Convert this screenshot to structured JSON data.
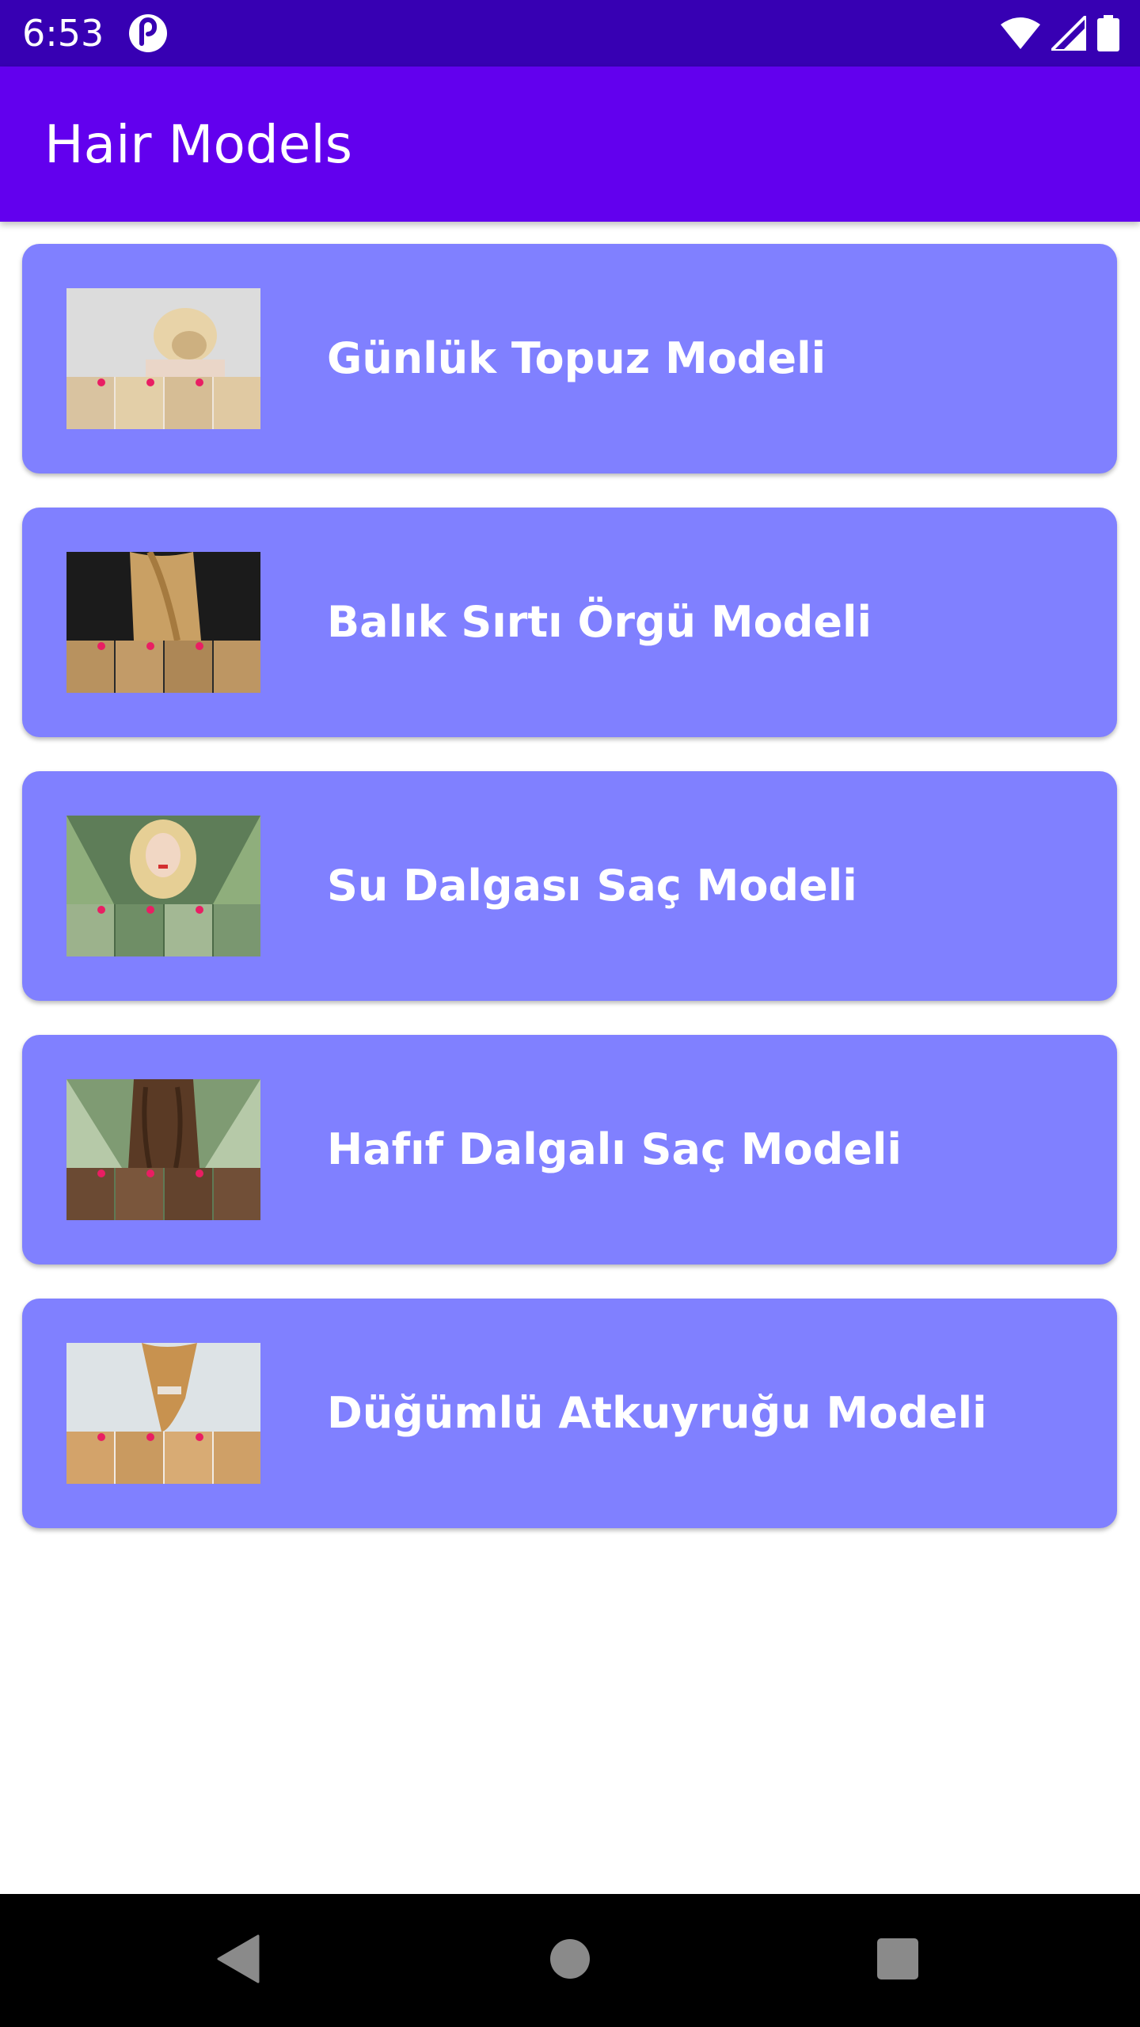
{
  "status_bar": {
    "time": "6:53",
    "icons": [
      "app-notification-icon",
      "wifi-icon",
      "signal-icon",
      "battery-icon"
    ]
  },
  "app_bar": {
    "title": "Hair Models",
    "color": "#6200ee"
  },
  "colors": {
    "status_bar": "#3700b3",
    "card_background": "#8080ff",
    "card_text": "#ffffff"
  },
  "models": [
    {
      "label": "Günlük Topuz Modeli",
      "thumbnail": "bun-hairstyle-tutorial-image"
    },
    {
      "label": "Balık Sırtı Örgü Modeli",
      "thumbnail": "fishtail-braid-tutorial-image"
    },
    {
      "label": "Su Dalgası Saç Modeli",
      "thumbnail": "water-wave-hair-tutorial-image"
    },
    {
      "label": "Hafıf Dalgalı Saç Modeli",
      "thumbnail": "light-wavy-hair-tutorial-image"
    },
    {
      "label": "Düğümlü Atkuyruğu Modeli",
      "thumbnail": "knotted-ponytail-tutorial-image"
    }
  ],
  "nav_bar": {
    "buttons": [
      "back-icon",
      "home-icon",
      "recents-icon"
    ]
  }
}
